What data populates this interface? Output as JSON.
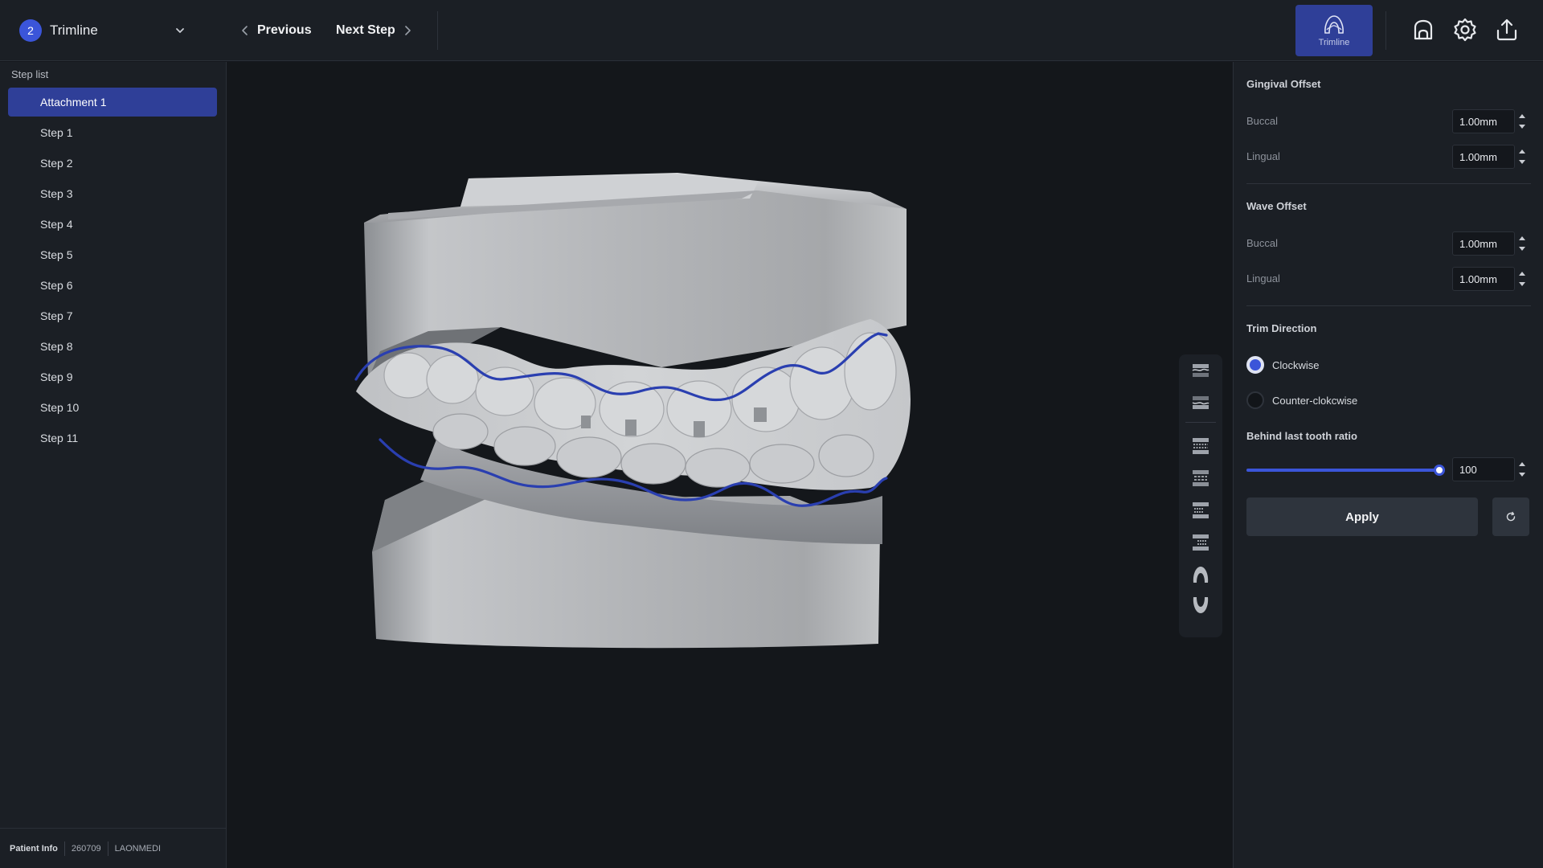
{
  "header": {
    "mode_number": "2",
    "mode_label": "Trimline",
    "previous_label": "Previous",
    "next_label": "Next Step",
    "active_tool_label": "Trimline"
  },
  "sidebar": {
    "title": "Step list",
    "steps": [
      {
        "label": "Attachment 1",
        "active": true
      },
      {
        "label": "Step 1"
      },
      {
        "label": "Step 2"
      },
      {
        "label": "Step 3"
      },
      {
        "label": "Step 4"
      },
      {
        "label": "Step 5"
      },
      {
        "label": "Step 6"
      },
      {
        "label": "Step 7"
      },
      {
        "label": "Step 8"
      },
      {
        "label": "Step 9"
      },
      {
        "label": "Step 10"
      },
      {
        "label": "Step 11"
      }
    ],
    "patient": {
      "label": "Patient Info",
      "id": "260709",
      "name": "LAONMEDI"
    }
  },
  "view_toolbar": {
    "icons": [
      "view-upper-top-icon",
      "view-upper-bottom-icon",
      "view-front-icon",
      "view-back-icon",
      "view-left-icon",
      "view-right-icon",
      "view-maxilla-icon",
      "view-mandible-icon"
    ]
  },
  "panel": {
    "gingival_offset": {
      "title": "Gingival Offset",
      "buccal_label": "Buccal",
      "buccal_value": "1.00mm",
      "lingual_label": "Lingual",
      "lingual_value": "1.00mm"
    },
    "wave_offset": {
      "title": "Wave Offset",
      "buccal_label": "Buccal",
      "buccal_value": "1.00mm",
      "lingual_label": "Lingual",
      "lingual_value": "1.00mm"
    },
    "trim_direction": {
      "title": "Trim Direction",
      "options": [
        "Clockwise",
        "Counter-clokcwise"
      ],
      "selected": "Clockwise"
    },
    "behind_last_tooth": {
      "title": "Behind last tooth ratio",
      "value": "100",
      "fraction": 1.0
    },
    "apply_label": "Apply"
  },
  "colors": {
    "accent": "#3b55d9",
    "active_bg": "#2f3f98",
    "panel_bg": "#1b1f25",
    "viewport_bg": "#14171b",
    "trimline": "#2a3fb0"
  }
}
